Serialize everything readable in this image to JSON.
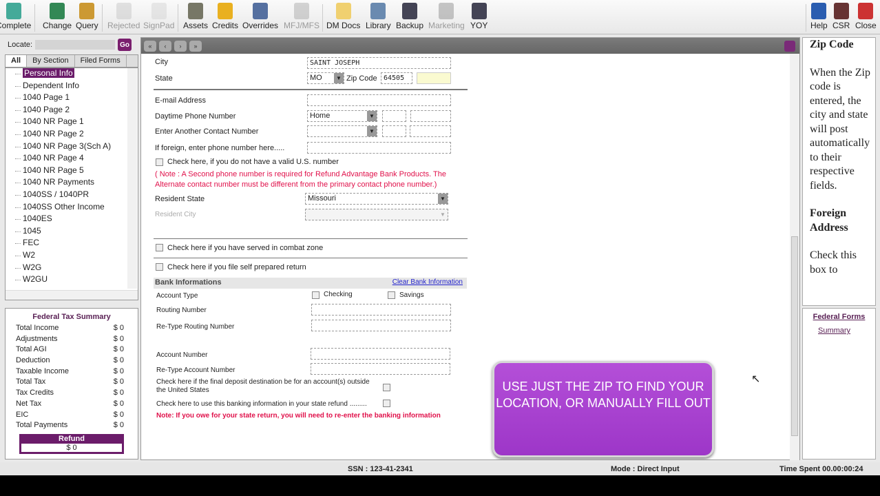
{
  "toolbar": {
    "items": [
      {
        "label": "Complete",
        "icon": "complete-icon",
        "enabled": true
      },
      {
        "label": "Change",
        "icon": "change-user-icon",
        "enabled": true
      },
      {
        "label": "Query",
        "icon": "query-icon",
        "enabled": true
      },
      {
        "label": "Rejected",
        "icon": "rejected-icon",
        "enabled": false
      },
      {
        "label": "SignPad",
        "icon": "signpad-icon",
        "enabled": false
      },
      {
        "label": "Assets",
        "icon": "clipboard-icon",
        "enabled": true
      },
      {
        "label": "Credits",
        "icon": "coins-icon",
        "enabled": true
      },
      {
        "label": "Overrides",
        "icon": "overrides-icon",
        "enabled": true
      },
      {
        "label": "MFJ/MFS",
        "icon": "mfj-icon",
        "enabled": false
      },
      {
        "label": "DM Docs",
        "icon": "folder-icon",
        "enabled": true
      },
      {
        "label": "Library",
        "icon": "library-icon",
        "enabled": true
      },
      {
        "label": "Backup",
        "icon": "backup-icon",
        "enabled": true
      },
      {
        "label": "Marketing",
        "icon": "briefcase-icon",
        "enabled": false
      },
      {
        "label": "YOY",
        "icon": "yoy-icon",
        "enabled": true
      },
      {
        "label": "Help",
        "icon": "help-icon",
        "enabled": true
      },
      {
        "label": "CSR",
        "icon": "csr-icon",
        "enabled": true
      },
      {
        "label": "Close",
        "icon": "close-icon",
        "enabled": true
      }
    ]
  },
  "locate": {
    "label": "Locate:",
    "value": "",
    "go": "Go"
  },
  "tabs": [
    "All",
    "By Section",
    "Filed Forms"
  ],
  "tree": [
    "Personal Info",
    "Dependent Info",
    "1040 Page 1",
    "1040 Page 2",
    "1040 NR Page 1",
    "1040 NR Page 2",
    "1040 NR Page 3(Sch A)",
    "1040 NR Page 4",
    "1040 NR Page 5",
    "1040 NR Payments",
    "1040SS / 1040PR",
    "1040SS Other Income",
    "1040ES",
    "1045",
    "FEC",
    "W2",
    "W2G",
    "W2GU"
  ],
  "summary": {
    "title": "Federal Tax Summary",
    "rows": [
      [
        "Total Income",
        "$ 0"
      ],
      [
        "Adjustments",
        "$ 0"
      ],
      [
        "Total AGI",
        "$ 0"
      ],
      [
        "Deduction",
        "$ 0"
      ],
      [
        "Taxable Income",
        "$ 0"
      ],
      [
        "Total Tax",
        "$ 0"
      ],
      [
        "Tax Credits",
        "$ 0"
      ],
      [
        "Net Tax",
        "$ 0"
      ],
      [
        "EIC",
        "$ 0"
      ],
      [
        "Total Payments",
        "$ 0"
      ]
    ],
    "refund_label": "Refund",
    "refund_value": "$ 0"
  },
  "form": {
    "city_label": "City",
    "city": "SAINT JOSEPH",
    "state_label": "State",
    "state": "MO",
    "zip_label": "Zip Code",
    "zip": "64505",
    "email_label": "E-mail Address",
    "day_phone_label": "Daytime Phone Number",
    "day_phone_type": "Home",
    "another_label": "Enter Another Contact Number",
    "foreign_label": "If foreign, enter phone number here.....",
    "no_us_label": "Check here, if you do not have a valid U.S. number",
    "note1": "( Note : A Second phone number is required for Refund Advantage Bank Products. The",
    "note2": "Alternate contact number must be different from the primary contact phone number.)",
    "res_state_label": "Resident State",
    "res_state": "Missouri",
    "res_city_label": "Resident City",
    "combat_label": "Check here if you have served in combat zone",
    "self_label": "Check here if you file self prepared return",
    "bank_title": "Bank Informations",
    "clear_bank": "Clear Bank Information",
    "acct_type_label": "Account Type",
    "checking": "Checking",
    "savings": "Savings",
    "routing_label": "Routing Number",
    "retype_routing_label": "Re-Type Routing Number",
    "account_label": "Account Number",
    "retype_account_label": "Re-Type Account Number",
    "foreign_dep1": "Check here if the final deposit destination be for an account(s) outside",
    "foreign_dep2": "the United States",
    "state_refund_label": "Check here to use this banking information in your state refund .........",
    "note3": "Note:  If you owe for your state return, you will need to re-enter the banking information"
  },
  "banner": "USE JUST THE ZIP TO FIND YOUR LOCATION, OR MANUALLY FILL OUT",
  "help": {
    "h1": "Zip Code",
    "p1": "When the Zip code is entered, the city and state will post automatically to their respective fields.",
    "h2": "Foreign Address",
    "p2": "Check this box to"
  },
  "fedforms": {
    "title": "Federal Forms",
    "item": "Summary"
  },
  "status": {
    "ssn": "SSN   : 123-41-2341",
    "mode": "Mode : Direct Input",
    "time": "Time Spent  00.00:00:24"
  }
}
